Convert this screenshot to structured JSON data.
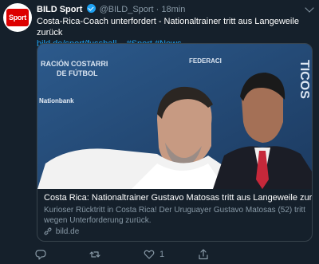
{
  "tweet": {
    "author_name": "BILD Sport",
    "handle": "@BILD_Sport",
    "separator": "·",
    "time": "18min",
    "avatar_label": "Sport",
    "text_line1": "Costa-Rica-Coach unterfordert - Nationaltrainer tritt aus Langeweile zurück",
    "link": "bild.de/sport/fussball...",
    "hashtag1": "#Sport",
    "hashtag2": "#News"
  },
  "card": {
    "title": "Costa Rica: Nationaltrainer Gustavo Matosas tritt aus Langeweile zurück",
    "description": "Kurioser Rücktritt in Costa Rica! Der Uruguayer Gustavo Matosas (52) tritt wegen Unterforderung zurück.",
    "domain": "bild.de",
    "image_backdrop_text": {
      "line1": "RACIÓN COSTARRI",
      "line2": "DE FÚTBOL",
      "sponsor1": "Nationbank",
      "sponsor2": "FEDERACI",
      "side": "TICOS"
    }
  },
  "actions": {
    "reply_count": "",
    "retweet_count": "",
    "like_count": "1",
    "share_count": ""
  },
  "colors": {
    "background": "#15202b",
    "link": "#1da1f2",
    "muted": "#8899a6",
    "border": "#38444d",
    "brand_red": "#dd0000"
  },
  "icons": [
    "reply-icon",
    "retweet-icon",
    "like-icon",
    "share-icon",
    "link-icon",
    "verified-icon",
    "chevron-down-icon"
  ]
}
